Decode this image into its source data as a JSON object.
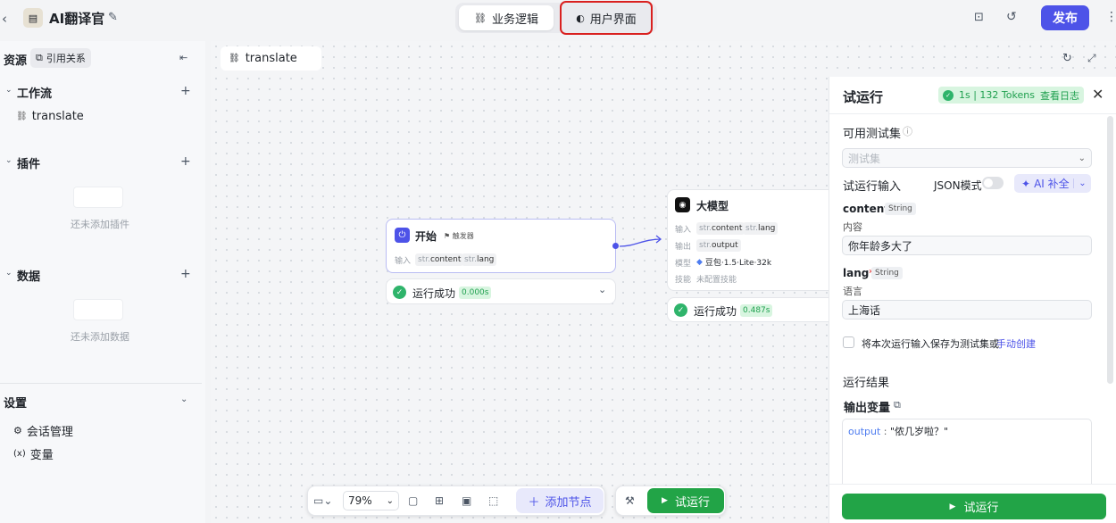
{
  "header": {
    "title": "AI翻译官",
    "tabs": [
      {
        "label": "业务逻辑"
      },
      {
        "label": "用户界面"
      }
    ],
    "publish_label": "发布"
  },
  "sidebar": {
    "resources_label": "资源",
    "refs_label": "引用关系",
    "workflow": {
      "label": "工作流",
      "items": [
        {
          "label": "translate"
        }
      ]
    },
    "plugins": {
      "label": "插件",
      "empty": "还未添加插件"
    },
    "data": {
      "label": "数据",
      "empty": "还未添加数据"
    },
    "settings": {
      "label": "设置",
      "items": [
        {
          "label": "会话管理"
        },
        {
          "label": "变量"
        }
      ]
    }
  },
  "canvas": {
    "tab_label": "translate",
    "start_node": {
      "title": "开始",
      "badge": "触发器",
      "input_label": "输入",
      "inputs": [
        "content",
        "lang"
      ],
      "type_prefix": "str.",
      "status": "运行成功",
      "time": "0.000s"
    },
    "llm_node": {
      "title": "大模型",
      "input_label": "输入",
      "inputs": [
        "content",
        "lang"
      ],
      "output_label": "输出",
      "outputs": [
        "output"
      ],
      "model_label": "模型",
      "model": "豆包·1.5·Lite·32k",
      "skill_label": "技能",
      "skill": "未配置技能",
      "status": "运行成功",
      "time": "0.487s"
    },
    "toolbar": {
      "zoom": "79%",
      "add_node": "添加节点",
      "run": "试运行"
    }
  },
  "panel": {
    "title": "试运行",
    "result_badge": "1s | 132 Tokens",
    "view_log": "查看日志",
    "testset_label": "可用测试集",
    "testset_placeholder": "测试集",
    "input_label": "试运行输入",
    "json_mode": "JSON模式",
    "ai_fill": "AI 补全",
    "fields": [
      {
        "name": "content",
        "type": "String",
        "desc": "内容",
        "value": "你年龄多大了"
      },
      {
        "name": "lang",
        "type": "String",
        "desc": "语言",
        "value": "上海话"
      }
    ],
    "save_text": "将本次运行输入保存为测试集或",
    "manual_create": "手动创建",
    "result_label": "运行结果",
    "output_var_label": "输出变量",
    "output_key": "output",
    "output_value": "\"侬几岁啦？\"",
    "run_button": "试运行"
  },
  "colors": {
    "accent": "#4d53e8",
    "success": "#2fb46b",
    "highlight": "#d9201f"
  }
}
